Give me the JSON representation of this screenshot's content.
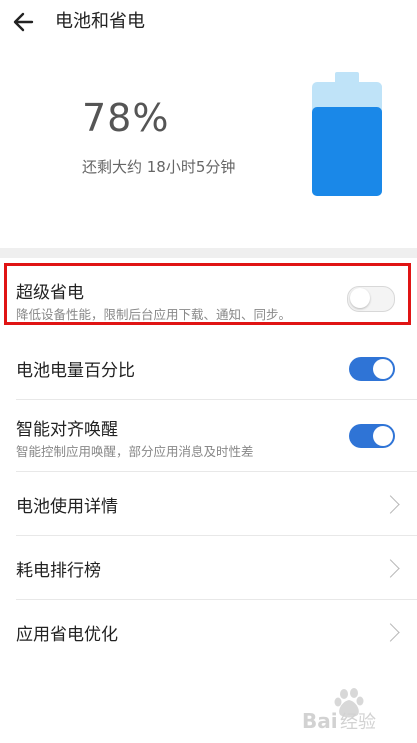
{
  "header": {
    "title": "电池和省电"
  },
  "battery": {
    "percent": "78%",
    "remaining": "还剩大约 18小时5分钟",
    "level": 0.78
  },
  "settings": [
    {
      "title": "超级省电",
      "subtitle": "降低设备性能，限制后台应用下载、通知、同步。",
      "toggle": "off"
    },
    {
      "title": "电池电量百分比",
      "toggle": "on"
    },
    {
      "title": "智能对齐唤醒",
      "subtitle": "智能控制应用唤醒，部分应用消息及时性差",
      "toggle": "on"
    },
    {
      "title": "电池使用详情"
    },
    {
      "title": "耗电排行榜"
    },
    {
      "title": "应用省电优化"
    }
  ],
  "watermark": {
    "text": "Bai经验"
  },
  "colors": {
    "accent": "#2f74d6",
    "battery": "#1a88e8",
    "highlight": "#e01414"
  }
}
